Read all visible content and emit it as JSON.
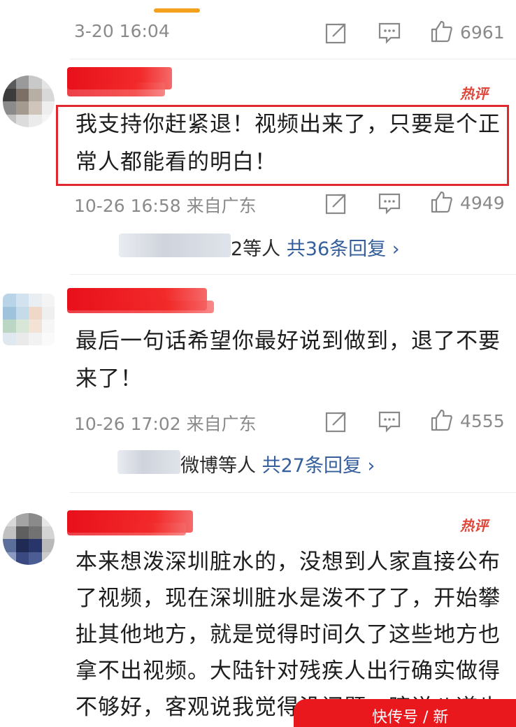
{
  "colors": {
    "accent": "#f2a11d",
    "hot": "#e0463a",
    "reply_link": "#345e9c",
    "highlight_box": "#e0282d"
  },
  "comments": [
    {
      "time": "3-20 16:04",
      "likes": "6961"
    },
    {
      "time": "10-26 16:58 来自广东",
      "hot_tag": "热评",
      "text_line1": "我支持你赶紧退！视频出来了，只要是个正",
      "text_line2": "常人都能看的明白！",
      "likes": "4949",
      "replies_prefix": "2等人",
      "replies_count": "共36条回复 ›"
    },
    {
      "time": "10-26 17:02 来自广东",
      "text_line1": "最后一句话希望你最好说到做到，退了不要",
      "text_line2": "来了！",
      "likes": "4555",
      "replies_prefix": "微博等人",
      "replies_count": "共27条回复 ›"
    },
    {
      "hot_tag": "热评",
      "text_line1": "本来想泼深圳脏水的，没想到人家直接公布",
      "text_line2": "了视频，现在深圳脏水是泼不了了，开始攀",
      "text_line3": "扯其他地方，就是觉得时间久了这些地方也",
      "text_line4": "拿不出视频。大陆针对残疾人出行确实做得",
      "text_line5": "不够好，客观说我觉得没问题，瞎说八道也"
    }
  ],
  "watermark": "快传号 / 新"
}
